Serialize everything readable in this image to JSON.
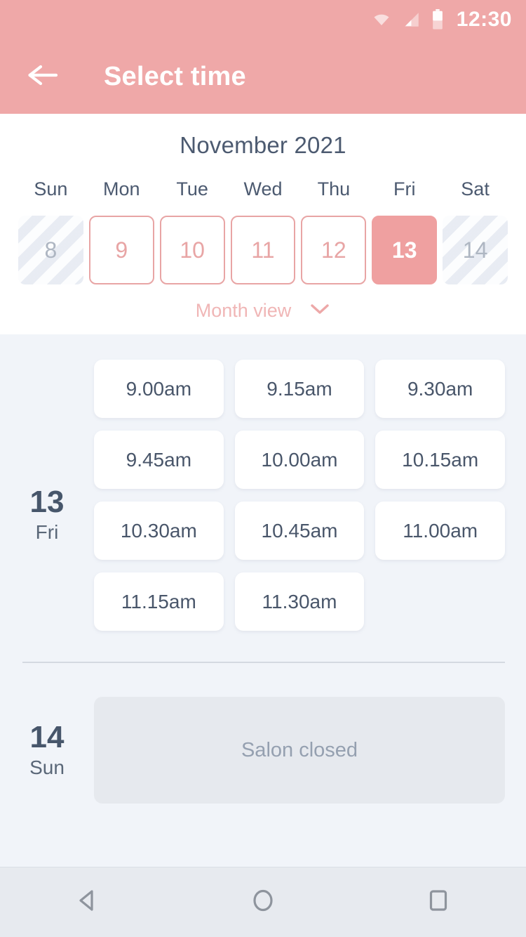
{
  "statusbar": {
    "time": "12:30",
    "icons": [
      "wifi-icon",
      "cell-signal-icon",
      "battery-icon"
    ]
  },
  "appbar": {
    "back_label": "back-arrow-icon",
    "title": "Select time"
  },
  "calendar": {
    "month_title": "November 2021",
    "weekday_names": [
      "Sun",
      "Mon",
      "Tue",
      "Wed",
      "Thu",
      "Fri",
      "Sat"
    ],
    "days": [
      {
        "num": "8",
        "state": "disabled"
      },
      {
        "num": "9",
        "state": "available"
      },
      {
        "num": "10",
        "state": "available"
      },
      {
        "num": "11",
        "state": "available"
      },
      {
        "num": "12",
        "state": "available"
      },
      {
        "num": "13",
        "state": "selected"
      },
      {
        "num": "14",
        "state": "disabled"
      }
    ],
    "month_view_label": "Month view",
    "month_view_chevron": "chevron-down-icon"
  },
  "schedule": [
    {
      "day_number": "13",
      "day_of_week": "Fri",
      "open": true,
      "slots": [
        "9.00am",
        "9.15am",
        "9.30am",
        "9.45am",
        "10.00am",
        "10.15am",
        "10.30am",
        "10.45am",
        "11.00am",
        "11.15am",
        "11.30am"
      ]
    },
    {
      "day_number": "14",
      "day_of_week": "Sun",
      "open": false,
      "closed_message": "Salon closed"
    }
  ],
  "navbar": {
    "back": "android-back-icon",
    "home": "android-home-icon",
    "recents": "android-recents-icon"
  },
  "colors": {
    "accent_pink": "#efa8a8",
    "selected_pink": "#efa0a0",
    "border_pink": "#e8a5a5",
    "text_dark": "#47566b",
    "bg_light": "#f1f4f9",
    "closed_card": "#e6e9ee",
    "closed_text": "#95a0b0"
  }
}
